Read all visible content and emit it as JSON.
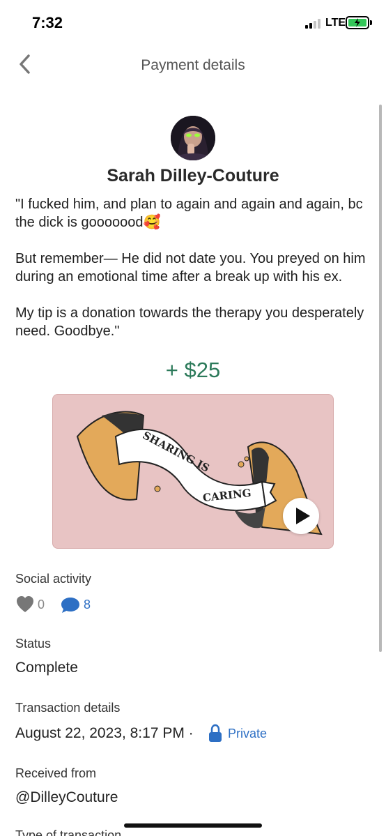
{
  "status_bar": {
    "time": "7:32",
    "network": "LTE"
  },
  "nav": {
    "title": "Payment details"
  },
  "payment": {
    "sender_name": "Sarah Dilley-Couture",
    "note": "\"I fucked him, and plan to again and again and again, bc the dick is gooooood🥰\n\nBut remember— He did not date you. You preyed on him during an emotional time after a break up with his ex.\n\nMy tip is a donation towards the therapy you desperately need. Goodbye.\"",
    "amount": "+ $25",
    "card_text_1": "SHARING IS",
    "card_text_2": "CARING"
  },
  "social": {
    "label": "Social activity",
    "likes": "0",
    "comments": "8"
  },
  "status": {
    "label": "Status",
    "value": "Complete"
  },
  "transaction": {
    "label": "Transaction details",
    "date": "August 22, 2023, 8:17 PM ·",
    "privacy": "Private"
  },
  "received": {
    "label": "Received from",
    "value": "@DilleyCouture"
  },
  "type": {
    "label": "Type of transaction"
  },
  "colors": {
    "accent_green": "#2c7a5a",
    "link_blue": "#2d6fc4",
    "card_pink": "#e8c4c4",
    "battery_green": "#33c759"
  },
  "icons": [
    "back-chevron-icon",
    "heart-icon",
    "comment-bubble-icon",
    "lock-icon",
    "play-icon",
    "battery-icon",
    "signal-icon"
  ]
}
